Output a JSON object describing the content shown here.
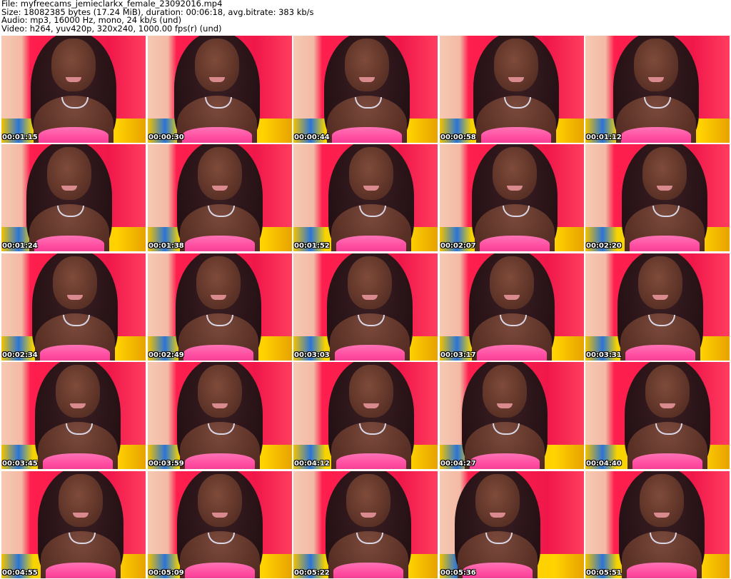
{
  "header": {
    "file_line": "File: myfreecams_jemieclarkx_female_23092016.mp4",
    "size_line": "Size: 18082385 bytes (17.24 MiB), duration: 00:06:18, avg.bitrate: 383 kb/s",
    "audio_line": "Audio: mp3, 16000 Hz, mono, 24 kb/s (und)",
    "video_line": "Video: h264, yuv420p, 320x240, 1000.00 fps(r) (und)"
  },
  "thumbnails": [
    {
      "timestamp": "00:01:15"
    },
    {
      "timestamp": "00:00:30"
    },
    {
      "timestamp": "00:00:44"
    },
    {
      "timestamp": "00:00:58"
    },
    {
      "timestamp": "00:01:12"
    },
    {
      "timestamp": "00:01:24"
    },
    {
      "timestamp": "00:01:38"
    },
    {
      "timestamp": "00:01:52"
    },
    {
      "timestamp": "00:02:07"
    },
    {
      "timestamp": "00:02:20"
    },
    {
      "timestamp": "00:02:34"
    },
    {
      "timestamp": "00:02:49"
    },
    {
      "timestamp": "00:03:03"
    },
    {
      "timestamp": "00:03:17"
    },
    {
      "timestamp": "00:03:31"
    },
    {
      "timestamp": "00:03:45"
    },
    {
      "timestamp": "00:03:59"
    },
    {
      "timestamp": "00:04:12"
    },
    {
      "timestamp": "00:04:27"
    },
    {
      "timestamp": "00:04:40"
    },
    {
      "timestamp": "00:04:55"
    },
    {
      "timestamp": "00:05:09"
    },
    {
      "timestamp": "00:05:22"
    },
    {
      "timestamp": "00:05:36"
    },
    {
      "timestamp": "00:05:51"
    }
  ]
}
